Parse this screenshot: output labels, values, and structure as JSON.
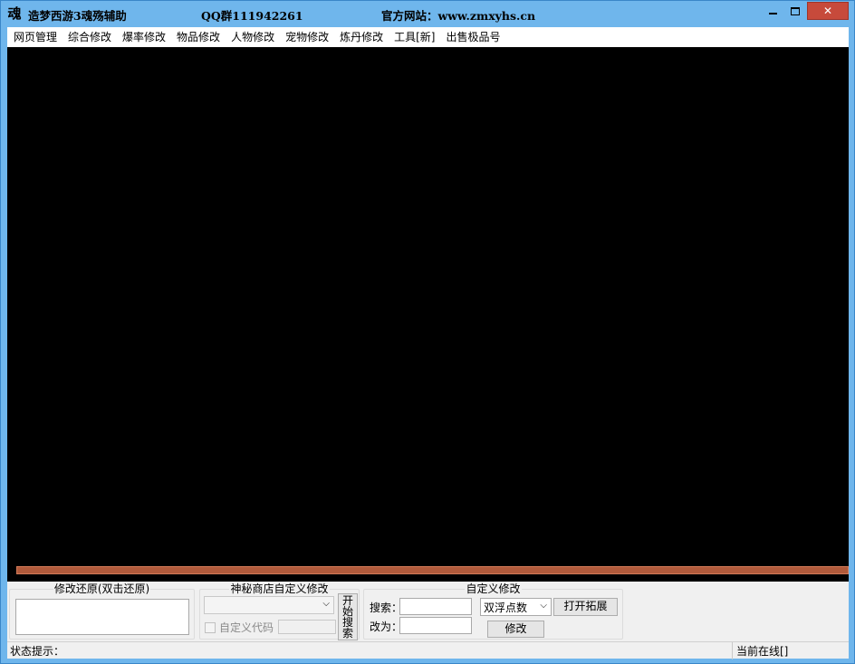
{
  "window": {
    "icon_glyph": "魂",
    "title": "造梦西游3魂殇辅助",
    "qq_group": "QQ群111942261",
    "website": "官方网站：www.zmxyhs.cn",
    "minimize_icon": "minimize-icon",
    "maximize_icon": "maximize-icon",
    "close_icon": "close-icon",
    "close_glyph": "✕"
  },
  "menu": [
    "网页管理",
    "综合修改",
    "爆率修改",
    "物品修改",
    "人物修改",
    "宠物修改",
    "炼丹修改",
    "工具[新]",
    "出售极品号"
  ],
  "progress": {
    "value": 1.0,
    "color": "#b05a3b"
  },
  "restore_group": {
    "title": "修改还原(双击还原)"
  },
  "shop_group": {
    "title": "神秘商店自定义修改",
    "select_value": "",
    "search_button_chars": [
      "开",
      "始",
      "搜",
      "索"
    ],
    "custom_code_label": "自定义代码",
    "custom_code_value": ""
  },
  "custom_group": {
    "title": "自定义修改",
    "search_label": "搜索：",
    "search_value": "",
    "change_label": "改为：",
    "change_value": "",
    "type_select": "双浮点数",
    "open_extension_button": "打开拓展",
    "modify_button": "修改"
  },
  "status": {
    "hint_label": "状态提示：",
    "online_label": "当前在线[]"
  }
}
